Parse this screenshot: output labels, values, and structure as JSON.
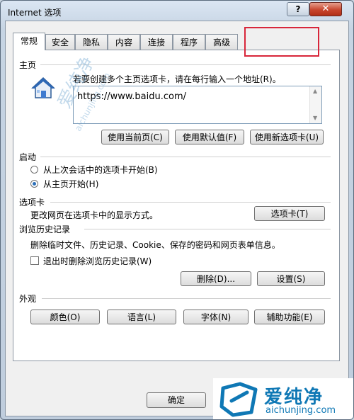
{
  "window": {
    "title": "Internet 选项",
    "help_label": "?",
    "close_label": "✕"
  },
  "tabs": [
    {
      "label": "常规",
      "active": true
    },
    {
      "label": "安全"
    },
    {
      "label": "隐私"
    },
    {
      "label": "内容"
    },
    {
      "label": "连接"
    },
    {
      "label": "程序"
    },
    {
      "label": "高级"
    }
  ],
  "home_page": {
    "title": "主页",
    "instruction": "若要创建多个主页选项卡，请在每行输入一个地址(R)。",
    "url_value": "https://www.baidu.com/",
    "use_current": "使用当前页(C)",
    "use_default": "使用默认值(F)",
    "use_new_tab": "使用新选项卡(U)"
  },
  "startup": {
    "title": "启动",
    "option_last_session": "从上次会话中的选项卡开始(B)",
    "option_home_page": "从主页开始(H)",
    "selected": "option_home_page"
  },
  "tabs_section": {
    "title": "选项卡",
    "description": "更改网页在选项卡中的显示方式。",
    "button": "选项卡(T)"
  },
  "history": {
    "title": "浏览历史记录",
    "description": "删除临时文件、历史记录、Cookie、保存的密码和网页表单信息。",
    "checkbox_label": "退出时删除浏览历史记录(W)",
    "delete_button": "删除(D)...",
    "settings_button": "设置(S)"
  },
  "appearance": {
    "title": "外观",
    "colors_button": "颜色(O)",
    "languages_button": "语言(L)",
    "fonts_button": "字体(N)",
    "accessibility_button": "辅助功能(E)"
  },
  "footer": {
    "ok_button": "确定"
  },
  "watermark": {
    "brand": "爱纯净",
    "url": "aichunjing.com"
  },
  "colors": {
    "highlight": "#d8263a",
    "accent": "#0f78b5"
  }
}
